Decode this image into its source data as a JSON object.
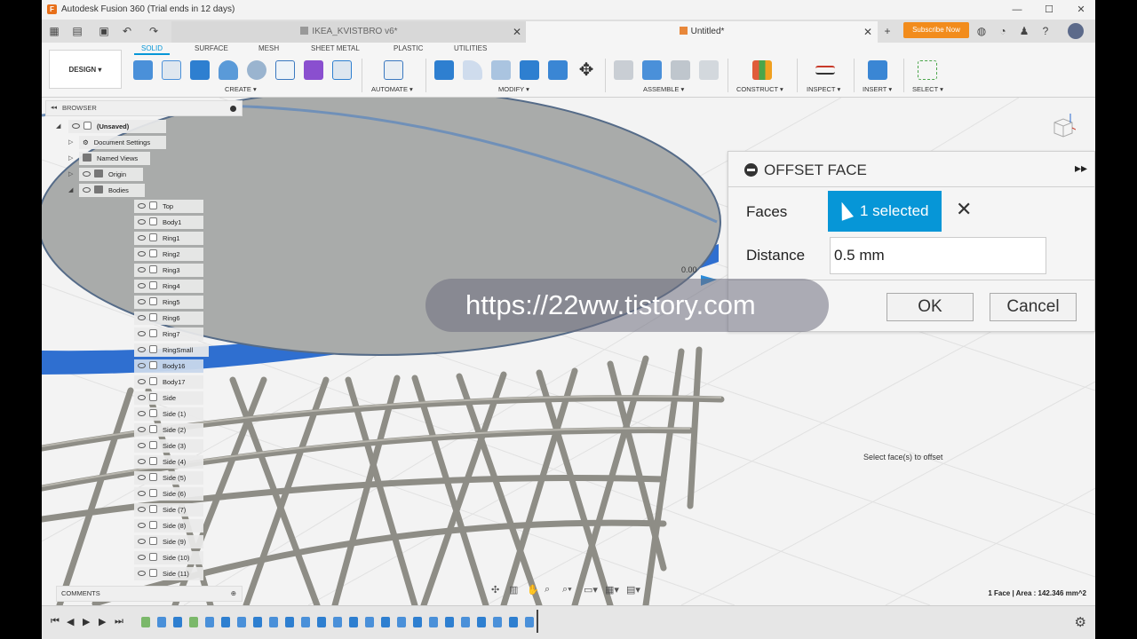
{
  "window": {
    "title": "Autodesk Fusion 360 (Trial ends in 12 days)",
    "logo": "F"
  },
  "tabs": [
    {
      "label": "IKEA_KVISTBRO v6*",
      "active": false
    },
    {
      "label": "Untitled*",
      "active": true
    }
  ],
  "subscribe_label": "Subscribe Now",
  "toolbar": {
    "design_label": "DESIGN ▾",
    "workspace_tabs": [
      "SOLID",
      "SURFACE",
      "MESH",
      "SHEET METAL",
      "PLASTIC",
      "UTILITIES"
    ],
    "groups": [
      "CREATE ▾",
      "AUTOMATE ▾",
      "MODIFY ▾",
      "ASSEMBLE ▾",
      "CONSTRUCT ▾",
      "INSPECT ▾",
      "INSERT ▾",
      "SELECT ▾"
    ]
  },
  "browser": {
    "header": "BROWSER",
    "root": "(Unsaved)",
    "folders": [
      "Document Settings",
      "Named Views",
      "Origin",
      "Bodies"
    ],
    "bodies": [
      "Top",
      "Body1",
      "Ring1",
      "Ring2",
      "Ring3",
      "Ring4",
      "Ring5",
      "Ring6",
      "Ring7",
      "RingSmall",
      "Body16",
      "Body17",
      "Side",
      "Side (1)",
      "Side (2)",
      "Side (3)",
      "Side (4)",
      "Side (5)",
      "Side (6)",
      "Side (7)",
      "Side (8)",
      "Side (9)",
      "Side (10)",
      "Side (11)"
    ],
    "comments": "COMMENTS"
  },
  "dialog": {
    "title": "OFFSET FACE",
    "faces_label": "Faces",
    "selection": "1 selected",
    "distance_label": "Distance",
    "distance_value": "0.5 mm",
    "ok": "OK",
    "cancel": "Cancel"
  },
  "viewport": {
    "watermark": "https://22ww.tistory.com",
    "status_hint": "Select face(s) to offset",
    "area_readout": "1 Face | Area : 142.346 mm^2",
    "manipulator_value": "0.00"
  },
  "colors": {
    "accent": "#0696d7",
    "subscribe": "#f28c1c",
    "selected_face": "#2f6fd0",
    "table_top": "#a9abaa"
  }
}
